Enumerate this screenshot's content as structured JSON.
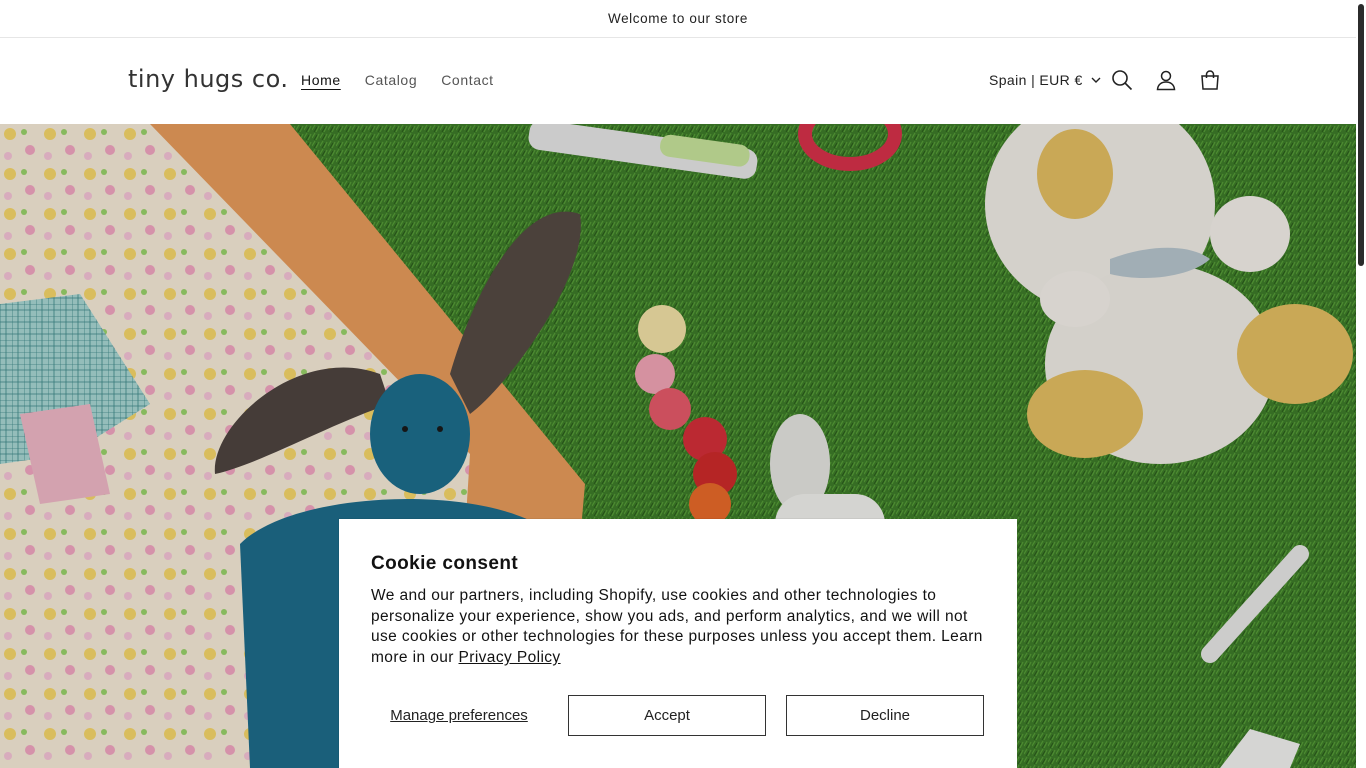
{
  "announcement": {
    "text": "Welcome to our store"
  },
  "header": {
    "logo": "tiny hugs co.",
    "nav": [
      {
        "label": "Home",
        "active": true
      },
      {
        "label": "Catalog",
        "active": false
      },
      {
        "label": "Contact",
        "active": false
      }
    ],
    "country_selector": "Spain | EUR €",
    "icons": [
      "search-icon",
      "account-icon",
      "cart-icon"
    ]
  },
  "cookie": {
    "title": "Cookie consent",
    "body": "We and our partners, including Shopify, use cookies and other technologies to personalize your experience, show you ads, and perform analytics, and we will not use cookies or other technologies for these purposes unless you accept them. Learn more in our",
    "link": "Privacy Policy",
    "manage": "Manage preferences",
    "accept": "Accept",
    "decline": "Decline"
  },
  "colors": {
    "grass": "#3f7d2a",
    "blanket_orange": "#e9a266",
    "bunny_blue": "#1f6f8f"
  }
}
